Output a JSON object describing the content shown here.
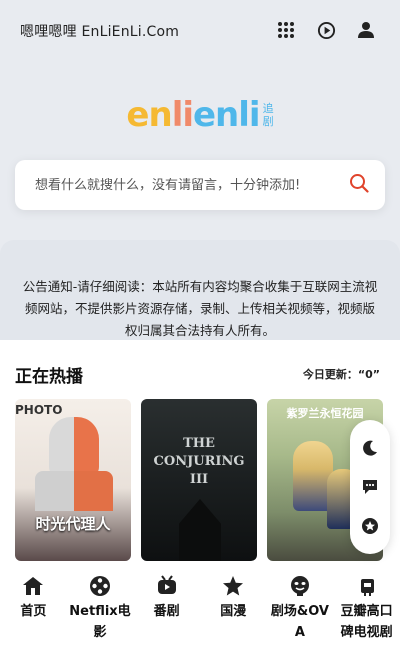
{
  "header": {
    "site_name": "嗯哩嗯哩 EnLiEnLi.Com",
    "icons": [
      "grid-icon",
      "play-circle-icon",
      "user-icon"
    ]
  },
  "logo": {
    "part1": "en",
    "part2": "li",
    "part3": "en",
    "part4": "li",
    "sub_top": "追",
    "sub_bottom": "剧"
  },
  "search": {
    "placeholder": "想看什么就搜什么，没有请留言，十分钟添加!",
    "icon": "search-icon"
  },
  "notice": {
    "text": "公告通知-请仔细阅读：本站所有内容均聚合收集于互联网主流视频网站，不提供影片资源存储，录制、上传相关视频等，视频版权归属其合法持有人所有。"
  },
  "hot": {
    "title": "正在热播",
    "update": "今日更新：“0”",
    "cards": [
      {
        "title": "时光代理人",
        "top_text": "PHOTO"
      },
      {
        "title": "THE CONJURING III"
      },
      {
        "title": "紫罗兰永恒花园"
      }
    ]
  },
  "float_buttons": [
    "moon-icon",
    "chat-icon",
    "star-icon"
  ],
  "bottom_nav": [
    {
      "label": "首页",
      "icon": "home-icon"
    },
    {
      "label": "Netflix电影",
      "icon": "film-reel-icon"
    },
    {
      "label": "番剧",
      "icon": "bilibili-tv-icon"
    },
    {
      "label": "国漫",
      "icon": "star-icon"
    },
    {
      "label": "剧场&OVA",
      "icon": "mask-icon"
    },
    {
      "label": "豆瓣高口碑电视剧",
      "icon": "tv-icon"
    }
  ],
  "colors": {
    "accent_red": "#e0432b",
    "logo_yellow": "#f5b933",
    "logo_orange": "#f08a6a",
    "logo_blue": "#4fb7ea"
  }
}
